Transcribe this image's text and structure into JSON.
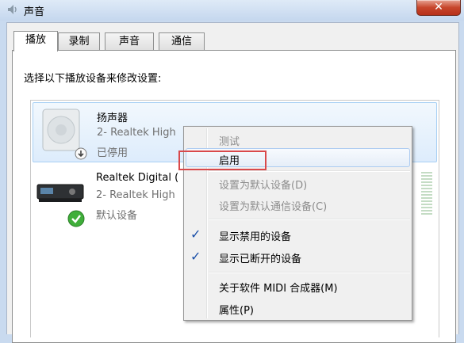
{
  "window": {
    "title": "声音",
    "close_glyph": "✕"
  },
  "tabs": [
    {
      "label": "播放",
      "active": true
    },
    {
      "label": "录制",
      "active": false
    },
    {
      "label": "声音",
      "active": false
    },
    {
      "label": "通信",
      "active": false
    }
  ],
  "instruction": "选择以下播放设备来修改设置:",
  "devices": [
    {
      "name": "扬声器",
      "line1": "2- Realtek High",
      "status": "已停用",
      "icon": "speaker-icon",
      "badge": "down-arrow-badge-icon"
    },
    {
      "name": "Realtek Digital (",
      "line1": "2- Realtek High",
      "status": "默认设备",
      "icon": "digital-receiver-icon",
      "badge": "green-check-badge-icon"
    }
  ],
  "context_menu": {
    "items": [
      {
        "label": "测试",
        "enabled": false,
        "checked": false
      },
      {
        "label": "启用",
        "enabled": true,
        "checked": false,
        "highlighted": true
      },
      {
        "label": "设置为默认设备(D)",
        "enabled": false,
        "checked": false
      },
      {
        "label": "设置为默认通信设备(C)",
        "enabled": false,
        "checked": false
      },
      {
        "label": "显示禁用的设备",
        "enabled": true,
        "checked": true
      },
      {
        "label": "显示已断开的设备",
        "enabled": true,
        "checked": true
      },
      {
        "label": "关于软件 MIDI 合成器(M)",
        "enabled": true,
        "checked": false
      },
      {
        "label": "属性(P)",
        "enabled": true,
        "checked": false
      }
    ],
    "check_glyph": "✓"
  },
  "colors": {
    "highlight_box": "#d9494b",
    "selection": "#ddecfc",
    "disabled_text": "#8d8d8d"
  }
}
